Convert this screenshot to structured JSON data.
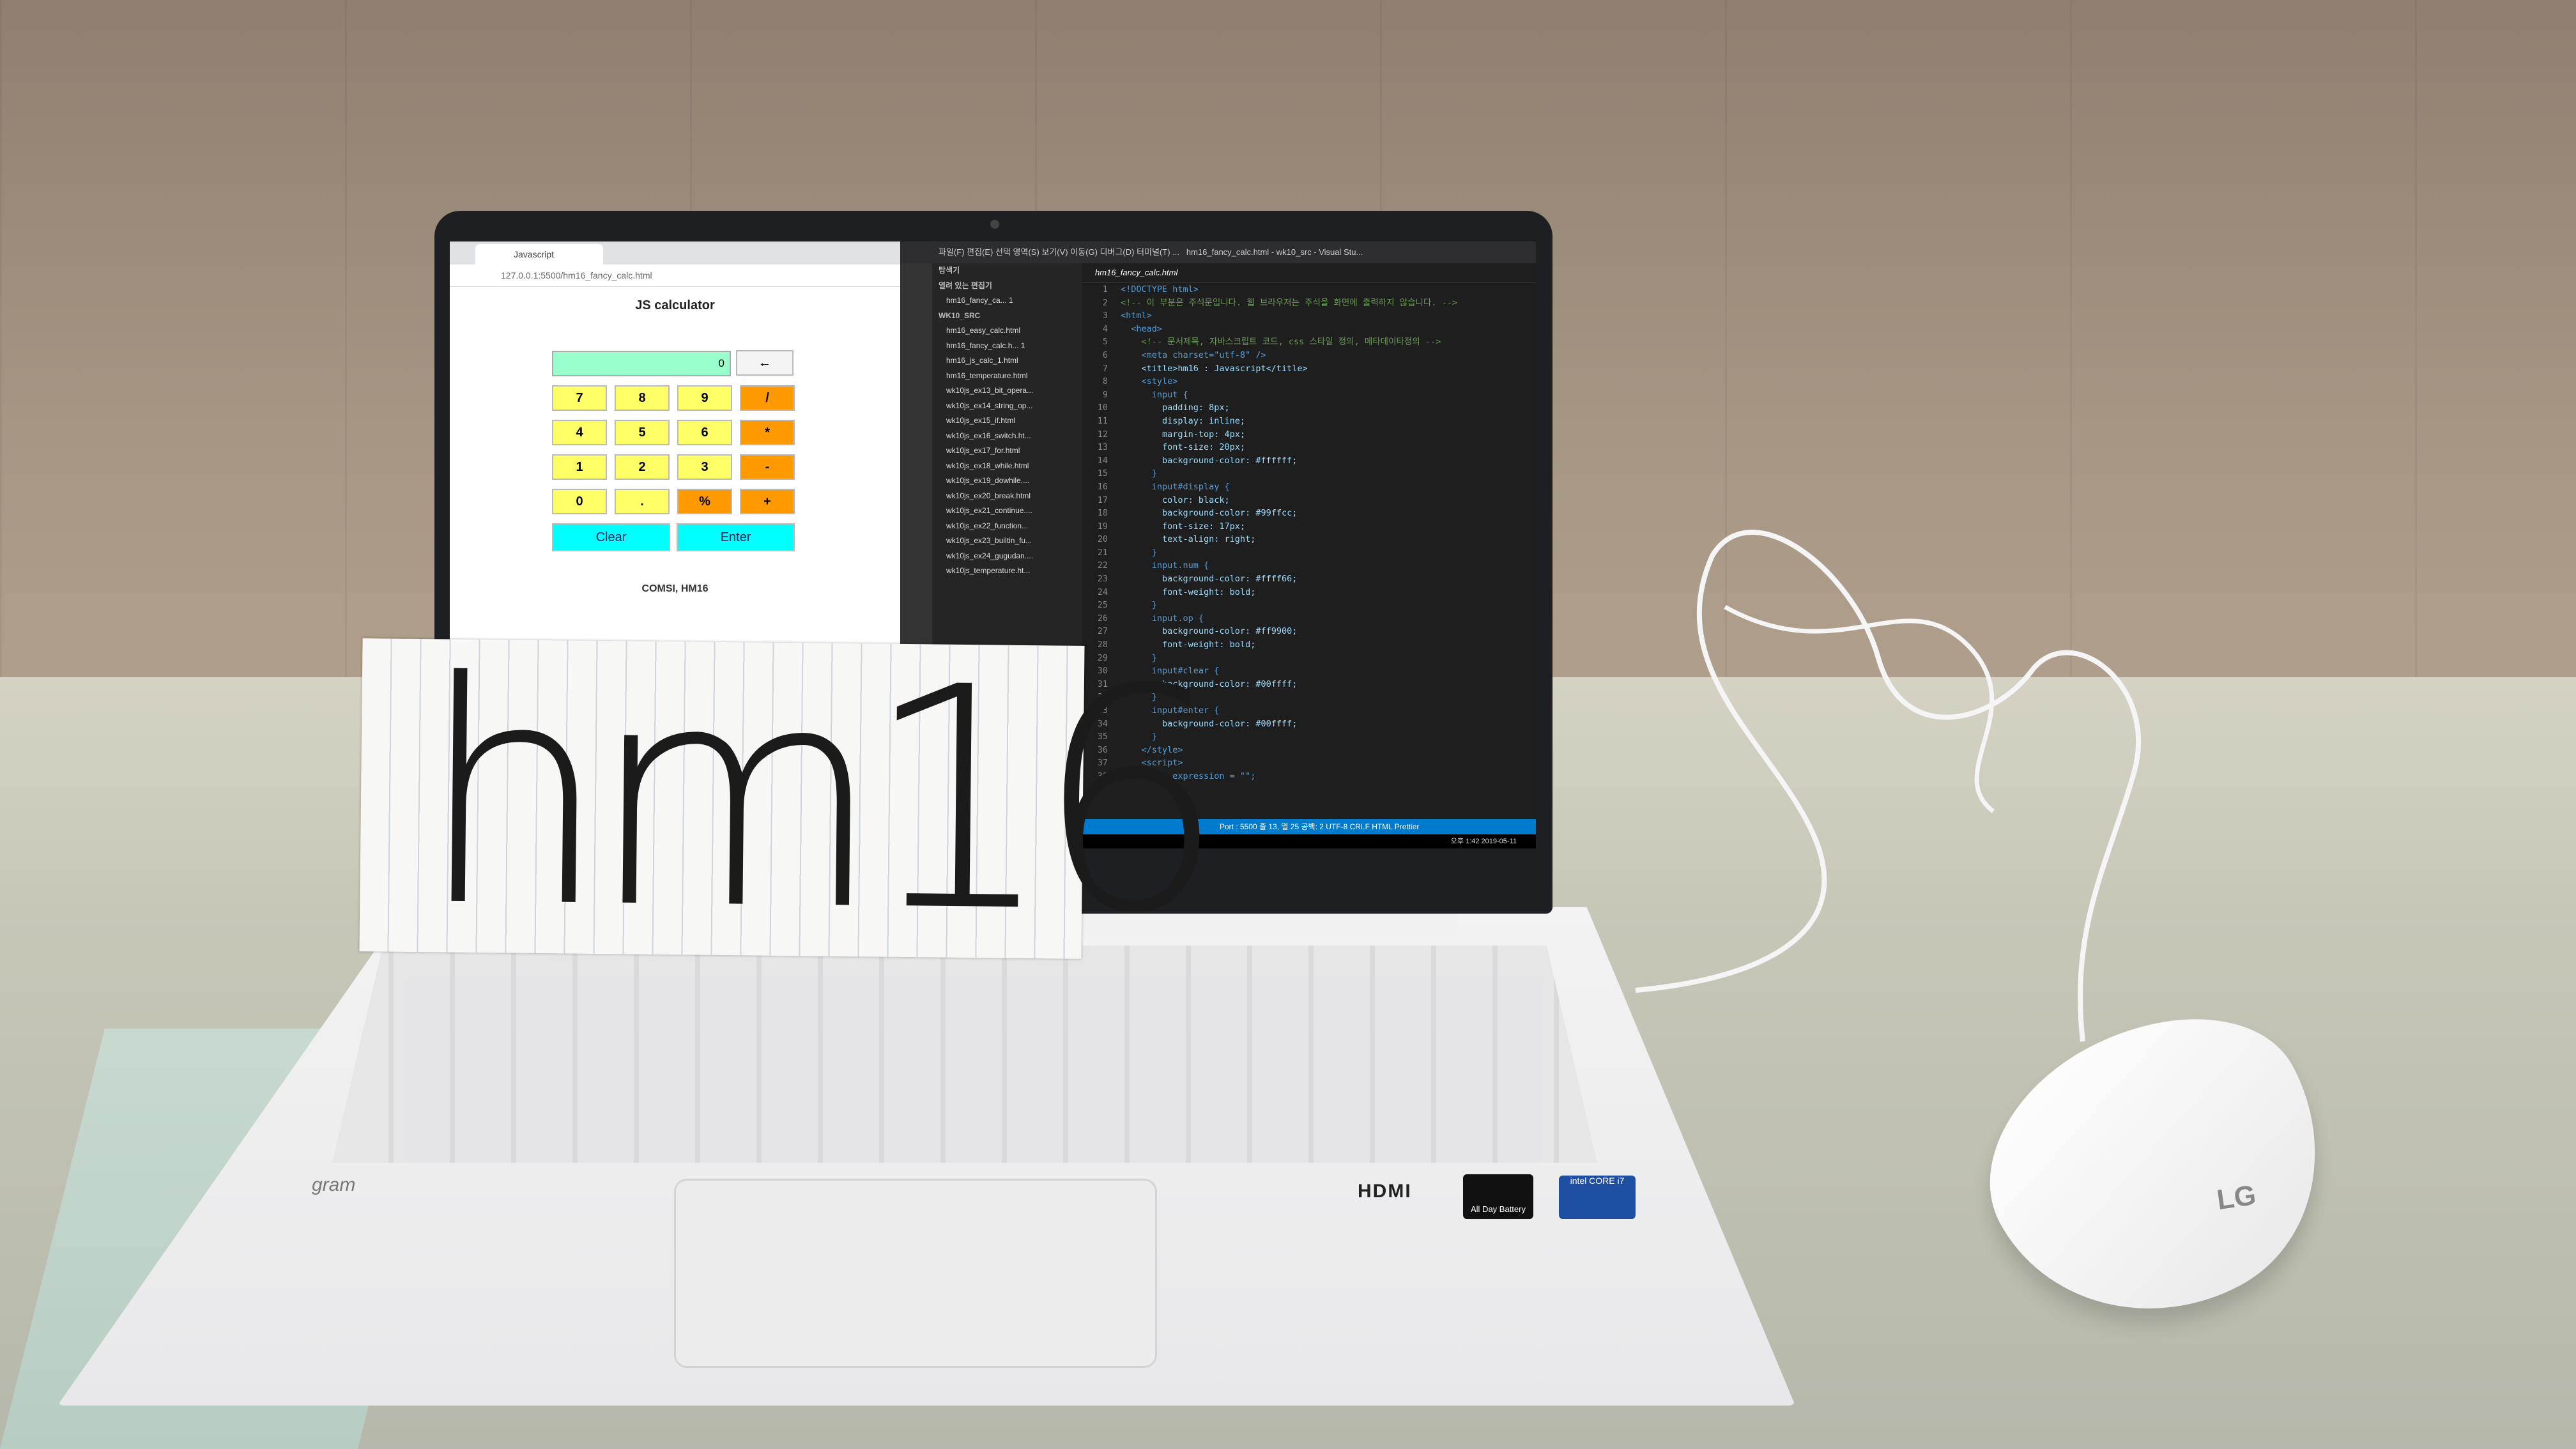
{
  "browser": {
    "tab_title": "Javascript",
    "url": "127.0.0.1:5500/hm16_fancy_calc.html",
    "calc_title": "JS calculator",
    "display_value": "0",
    "back_label": "←",
    "keys": [
      "7",
      "8",
      "9",
      "/",
      "4",
      "5",
      "6",
      "*",
      "1",
      "2",
      "3",
      "-",
      "0",
      ".",
      "%",
      "+"
    ],
    "clear_label": "Clear",
    "enter_label": "Enter",
    "footer": "COMSI, HM16"
  },
  "vscode": {
    "window_title": "hm16_fancy_calc.html - wk10_src - Visual Stu...",
    "menu": [
      "파일(F)",
      "편집(E)",
      "선택 영역(S)",
      "보기(V)",
      "이동(G)",
      "디버그(D)",
      "터미널(T)",
      "..."
    ],
    "explorer_title": "탐색기",
    "open_editors": "열려 있는 편집기",
    "open_file": "hm16_fancy_ca... 1",
    "folder": "WK10_SRC",
    "files": [
      "hm16_easy_calc.html",
      "hm16_fancy_calc.h... 1",
      "hm16_js_calc_1.html",
      "hm16_temperature.html",
      "wk10js_ex13_bit_opera...",
      "wk10js_ex14_string_op...",
      "wk10js_ex15_if.html",
      "wk10js_ex16_switch.ht...",
      "wk10js_ex17_for.html",
      "wk10js_ex18_while.html",
      "wk10js_ex19_dowhile....",
      "wk10js_ex20_break.html",
      "wk10js_ex21_continue....",
      "wk10js_ex22_function...",
      "wk10js_ex23_builtin_fu...",
      "wk10js_ex24_gugudan....",
      "wk10js_temperature.ht..."
    ],
    "editor_tab": "hm16_fancy_calc.html",
    "code_lines": [
      "<!DOCTYPE html>",
      "<!-- 이 부분은 주석문입니다. 웹 브라우저는 주석을 화면에 출력하지 않습니다. -->",
      "<html>",
      "  <head>",
      "    <!-- 문서제목, 자바스크립트 코드, css 스타일 정의, 메타데이타정의 -->",
      "    <meta charset=\"utf-8\" />",
      "    <title>hm16 : Javascript</title>",
      "    <style>",
      "      input {",
      "        padding: 8px;",
      "        display: inline;",
      "        margin-top: 4px;",
      "        font-size: 20px;",
      "        background-color: #ffffff;",
      "      }",
      "      input#display {",
      "        color: black;",
      "        background-color: #99ffcc;",
      "        font-size: 17px;",
      "        text-align: right;",
      "      }",
      "      input.num {",
      "        background-color: #ffff66;",
      "        font-weight: bold;",
      "      }",
      "      input.op {",
      "        background-color: #ff9900;",
      "        font-weight: bold;",
      "      }",
      "      input#clear {",
      "        background-color: #00ffff;",
      "      }",
      "      input#enter {",
      "        background-color: #00ffff;",
      "      }",
      "    </style>",
      "    <script>",
      "      var expression = \"\";"
    ],
    "status": "Port : 5500    줄 13, 열 25    공백: 2    UTF-8    CRLF    HTML    Prettier",
    "clock": "오후 1:42  2019-05-11"
  },
  "card_text": "hm16",
  "laptop": {
    "brand": "gram",
    "hdmi": "HDMI",
    "battery_badge": "All Day Battery",
    "intel_badge": "intel CORE i7"
  },
  "mouse_brand": "LG",
  "colors": {
    "display": "#99ffcc",
    "num": "#ffff66",
    "op": "#ff9900",
    "clear": "#00ffff",
    "vscode_status": "#007acc"
  }
}
